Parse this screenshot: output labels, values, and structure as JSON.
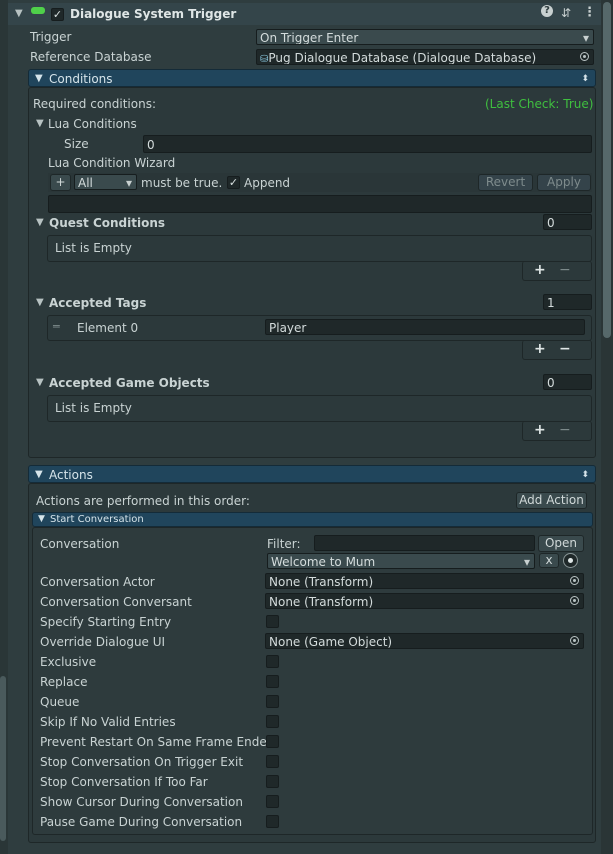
{
  "component": {
    "title": "Dialogue System Trigger",
    "enabled": true
  },
  "trigger": {
    "label": "Trigger",
    "value": "On Trigger Enter"
  },
  "reference_db": {
    "label": "Reference Database",
    "value": "Pug Dialogue Database (Dialogue Database)"
  },
  "conditions": {
    "header": "Conditions",
    "required_label": "Required conditions:",
    "last_check": "(Last Check: True)",
    "lua": {
      "header": "Lua Conditions",
      "size_label": "Size",
      "size_value": "0",
      "wizard_label": "Lua Condition Wizard",
      "plus": "+",
      "mode": "All",
      "must_be_true": "must be true.",
      "append_label": "Append",
      "revert": "Revert",
      "apply": "Apply"
    },
    "quest": {
      "header": "Quest Conditions",
      "count": "0",
      "empty": "List is Empty"
    },
    "tags": {
      "header": "Accepted Tags",
      "count": "1",
      "element_label": "Element 0",
      "element_value": "Player"
    },
    "game_objects": {
      "header": "Accepted Game Objects",
      "count": "0",
      "empty": "List is Empty"
    },
    "add": "+",
    "remove": "−"
  },
  "actions": {
    "header": "Actions",
    "order_label": "Actions are performed in this order:",
    "add_action": "Add Action",
    "start_conversation": {
      "header": "Start Conversation",
      "conversation_label": "Conversation",
      "filter_label": "Filter:",
      "filter_value": "",
      "open": "Open",
      "conversation_value": "Welcome to Mum",
      "clear": "x",
      "rows": [
        {
          "label": "Conversation Actor",
          "value": "None (Transform)"
        },
        {
          "label": "Conversation Conversant",
          "value": "None (Transform)"
        },
        {
          "label": "Specify Starting Entry"
        },
        {
          "label": "Override Dialogue UI",
          "value": "None (Game Object)"
        },
        {
          "label": "Exclusive"
        },
        {
          "label": "Replace"
        },
        {
          "label": "Queue"
        },
        {
          "label": "Skip If No Valid Entries"
        },
        {
          "label": "Prevent Restart On Same Frame Ended"
        },
        {
          "label": "Stop Conversation On Trigger Exit"
        },
        {
          "label": "Stop Conversation If Too Far"
        },
        {
          "label": "Show Cursor During Conversation"
        },
        {
          "label": "Pause Game During Conversation"
        }
      ]
    }
  },
  "colors": {
    "accent": "#20455c",
    "last_check": "#3fbf3f",
    "background": "#2f3d3f"
  }
}
